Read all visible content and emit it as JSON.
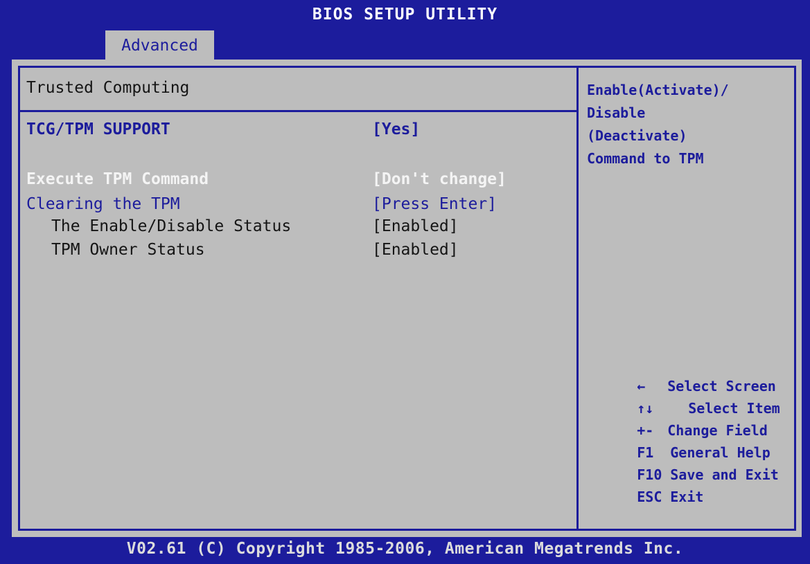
{
  "header": {
    "title": "BIOS SETUP UTILITY",
    "tab": "Advanced"
  },
  "main": {
    "section_title": "Trusted Computing",
    "rows": [
      {
        "label": "TCG/TPM SUPPORT",
        "value": "[Yes]"
      },
      {
        "label": "Execute TPM Command",
        "value": "[Don't change]"
      },
      {
        "label": "Clearing the TPM",
        "value": "[Press Enter]"
      },
      {
        "label": "The Enable/Disable Status",
        "value": "[Enabled]"
      },
      {
        "label": "TPM Owner Status",
        "value": "[Enabled]"
      }
    ]
  },
  "help": {
    "lines": [
      "Enable(Activate)/",
      "Disable",
      "(Deactivate)",
      "Command to TPM"
    ]
  },
  "keys": [
    {
      "key": "←",
      "desc": "Select Screen"
    },
    {
      "key": "↑↓",
      "desc": "Select Item"
    },
    {
      "key": "+-",
      "desc": "Change Field"
    },
    {
      "key": "F1",
      "desc": "General Help"
    },
    {
      "key": "F10",
      "desc": "Save and Exit"
    },
    {
      "key": "ESC",
      "desc": "Exit"
    }
  ],
  "footer": {
    "text": "V02.61 (C) Copyright 1985-2006, American Megatrends Inc."
  },
  "colors": {
    "background": "#1c1c9c",
    "panel": "#bdbdbd",
    "highlight": "#f4f4f4",
    "text": "#151515"
  }
}
